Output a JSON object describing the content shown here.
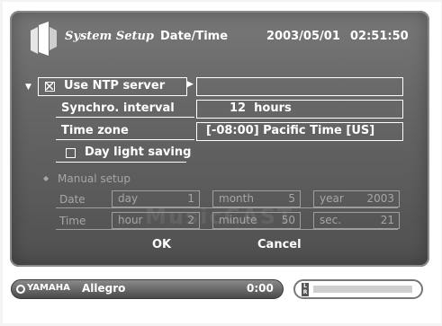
{
  "header": {
    "app_title": "System Setup",
    "page_title": "Date/Time",
    "date": "2003/05/01",
    "time": "02:51:50"
  },
  "ntp": {
    "label": "Use NTP server",
    "checked": true,
    "server_value": ""
  },
  "synchro": {
    "label": "Synchro. interval",
    "value": "12  hours"
  },
  "timezone": {
    "label": "Time zone",
    "value": "[-08:00] Pacific Time [US]"
  },
  "daylight": {
    "label": "Day light saving",
    "checked": false
  },
  "manual": {
    "label": "Manual setup",
    "date_label": "Date",
    "time_label": "Time",
    "day_label": "day",
    "day_value": "1",
    "month_label": "month",
    "month_value": "5",
    "year_label": "year",
    "year_value": "2003",
    "hour_label": "hour",
    "hour_value": "2",
    "minute_label": "minute",
    "minute_value": "50",
    "sec_label": "sec.",
    "sec_value": "21"
  },
  "buttons": {
    "ok": "OK",
    "cancel": "Cancel"
  },
  "player": {
    "brand": "YAMAHA",
    "track": "Allegro",
    "time": "0:00",
    "meter_labels": "LR"
  },
  "watermark": "MusicCAST"
}
